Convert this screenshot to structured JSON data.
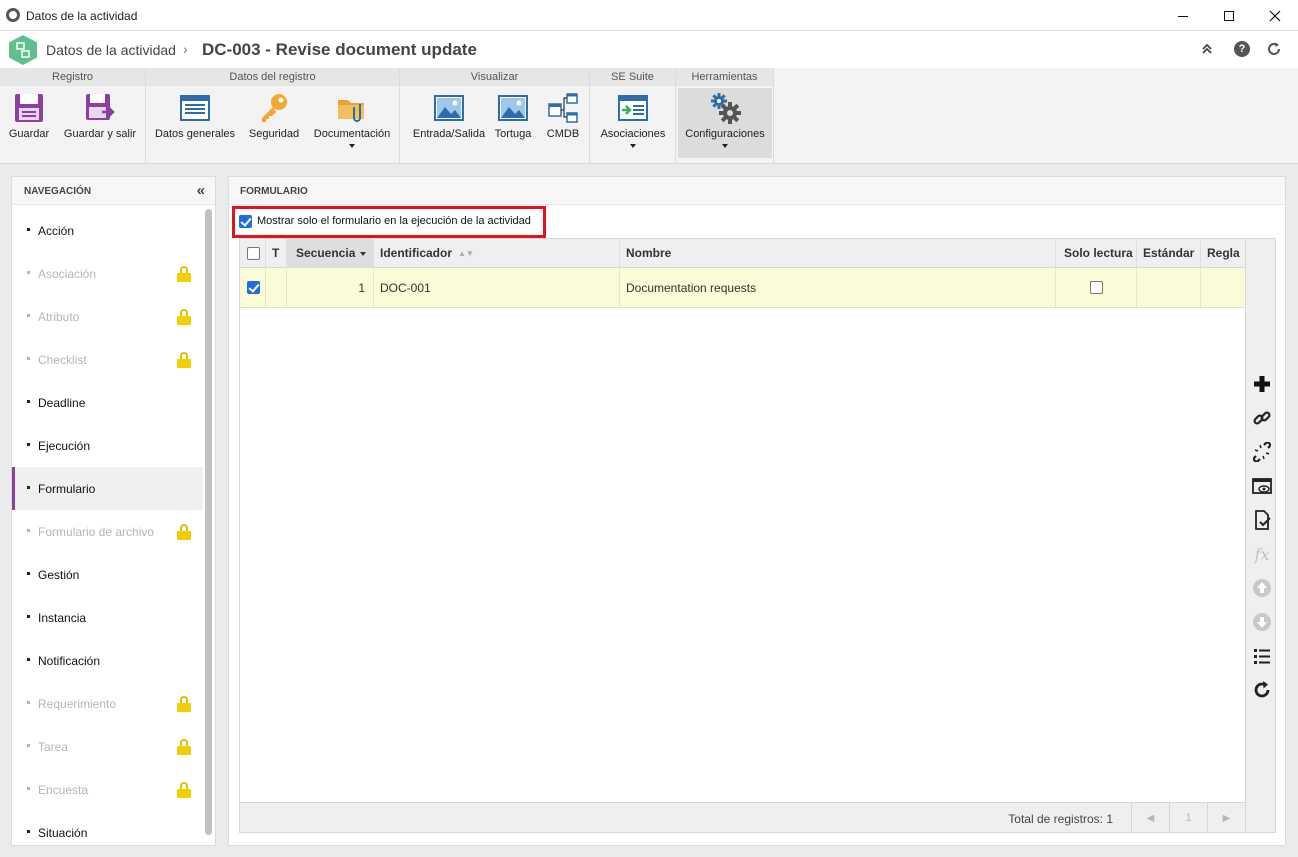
{
  "window": {
    "title": "Datos de la actividad"
  },
  "header": {
    "breadcrumb_root": "Datos de la actividad",
    "breadcrumb_sep": "›",
    "record_title": "DC-003 - Revise document update"
  },
  "ribbon": {
    "groups": {
      "registro": "Registro",
      "datos_registro": "Datos del registro",
      "visualizar": "Visualizar",
      "se_suite": "SE Suite",
      "herramientas": "Herramientas"
    },
    "buttons": {
      "guardar": "Guardar",
      "guardar_salir": "Guardar y salir",
      "datos_generales": "Datos generales",
      "seguridad": "Seguridad",
      "documentacion": "Documentación",
      "entrada_salida": "Entrada/Salida",
      "tortuga": "Tortuga",
      "cmdb": "CMDB",
      "asociaciones": "Asociaciones",
      "configuraciones": "Configuraciones"
    }
  },
  "nav": {
    "title": "NAVEGACIÓN",
    "items": [
      {
        "label": "Acción",
        "locked": false
      },
      {
        "label": "Asociación",
        "locked": true
      },
      {
        "label": "Atributo",
        "locked": true
      },
      {
        "label": "Checklist",
        "locked": true
      },
      {
        "label": "Deadline",
        "locked": false
      },
      {
        "label": "Ejecución",
        "locked": false
      },
      {
        "label": "Formulario",
        "locked": false,
        "active": true
      },
      {
        "label": "Formulario de archivo",
        "locked": true
      },
      {
        "label": "Gestión",
        "locked": false
      },
      {
        "label": "Instancia",
        "locked": false
      },
      {
        "label": "Notificación",
        "locked": false
      },
      {
        "label": "Requerimiento",
        "locked": true
      },
      {
        "label": "Tarea",
        "locked": true
      },
      {
        "label": "Encuesta",
        "locked": true
      },
      {
        "label": "Situación",
        "locked": false
      }
    ]
  },
  "form": {
    "title": "FORMULARIO",
    "show_only_form_label": "Mostrar solo el formulario en la ejecución de la actividad",
    "show_only_form_checked": true,
    "columns": {
      "t": "T",
      "secuencia": "Secuencia",
      "identificador": "Identificador",
      "nombre": "Nombre",
      "solo_lectura": "Solo lectura",
      "estandar": "Estándar",
      "regla": "Regla"
    },
    "rows": [
      {
        "secuencia": "1",
        "identificador": "DOC-001",
        "nombre": "Documentation requests",
        "selected": true,
        "solo_lectura": false
      }
    ],
    "footer": {
      "total": "Total de registros: 1",
      "page": "1"
    }
  },
  "colors": {
    "accent": "#8c3fa0",
    "highlight_border": "#e0141e",
    "row_highlight": "#fbfbd8",
    "lock": "#f2cf00"
  }
}
